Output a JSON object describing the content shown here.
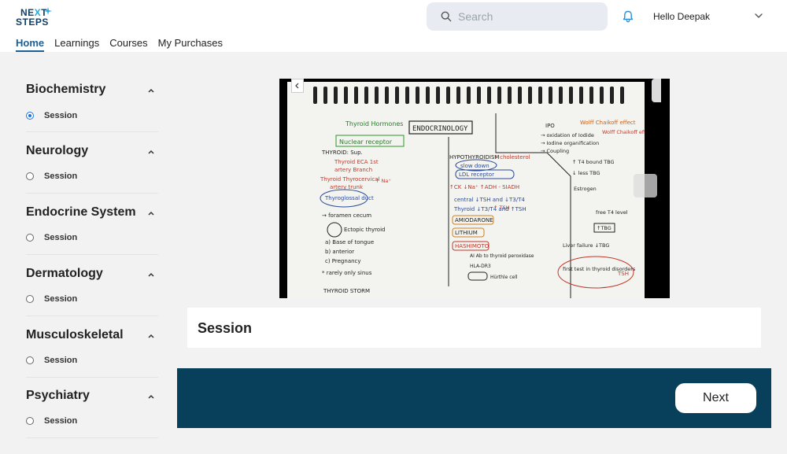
{
  "header": {
    "logo": {
      "line1": "NE T",
      "accent": "X",
      "line2": "STEPS"
    },
    "search": {
      "placeholder": "Search"
    },
    "greeting": "Hello Deepak"
  },
  "nav": {
    "items": [
      {
        "label": "Home",
        "active": true
      },
      {
        "label": "Learnings",
        "active": false
      },
      {
        "label": "Courses",
        "active": false
      },
      {
        "label": "My Purchases",
        "active": false
      }
    ]
  },
  "sidebar": {
    "sections": [
      {
        "title": "Biochemistry",
        "session_label": "Session",
        "selected": true
      },
      {
        "title": "Neurology",
        "session_label": "Session",
        "selected": false
      },
      {
        "title": "Endocrine System",
        "session_label": "Session",
        "selected": false
      },
      {
        "title": "Dermatology",
        "session_label": "Session",
        "selected": false
      },
      {
        "title": "Musculoskeletal",
        "session_label": "Session",
        "selected": false
      },
      {
        "title": "Psychiatry",
        "session_label": "Session",
        "selected": false
      }
    ]
  },
  "main": {
    "video": {
      "notes": {
        "heading": "ENDOCRINOLOGY",
        "left_top": "Thyroid Hormones",
        "left_box": "Nuclear receptor",
        "left_lines": [
          "THYROID: Sup.",
          "Thyroid ECA 1st",
          "artery Branch",
          "Thyroid Thyrocervical",
          "artery trunk",
          "Thyroglossal duct",
          "→ foramen cecum",
          "Ectopic thyroid",
          "a) Base of tongue",
          "b) anterior",
          "c) Pregnancy",
          "* rarely only sinus"
        ],
        "middle_lines": [
          "HYPOTHYROIDISM",
          "slow down",
          "LDL receptor",
          "↑CK ↓Na⁺ ↑ADH - SIADH",
          "central ↓TSH and ↓T3/T4",
          "Thyroid ↓T3/T4 and ↑TSH",
          "AMIODARONE",
          "LITHIUM",
          "HASHIMOTO",
          "AI Ab to thyroid peroxidase",
          "HLA-DR3",
          "Hürthle cell",
          "THYROID STORM"
        ],
        "right_lines": [
          "IPO",
          "Wolff Chaikoff effect",
          "→ oxidation of Iodide",
          "→ Iodine organification",
          "→ Coupling",
          "↑ T4 bound TBG",
          "↓ less TBG",
          "Estrogen",
          "free T4 level",
          "↑TBG",
          "Liver failure ↓TBG",
          "first test in thyroid disorders",
          "TSH"
        ],
        "red_notes": [
          "Wolff Chaikoff effect",
          "↑ cholesterol",
          "↑ Na⁺",
          "↑ TSH"
        ]
      }
    },
    "session_title": "Session",
    "next_label": "Next"
  },
  "colors": {
    "brand_navy": "#123f66",
    "brand_accent": "#29a8df",
    "nav_active": "#1a5f95",
    "footer": "#08405c",
    "radio_selected": "#1a73e8",
    "search_bg": "#e8ecf2"
  },
  "icons": {
    "search": "search-icon",
    "bell": "bell-icon",
    "chevron": "chevron-down-icon",
    "caret": "caret-up-icon"
  }
}
